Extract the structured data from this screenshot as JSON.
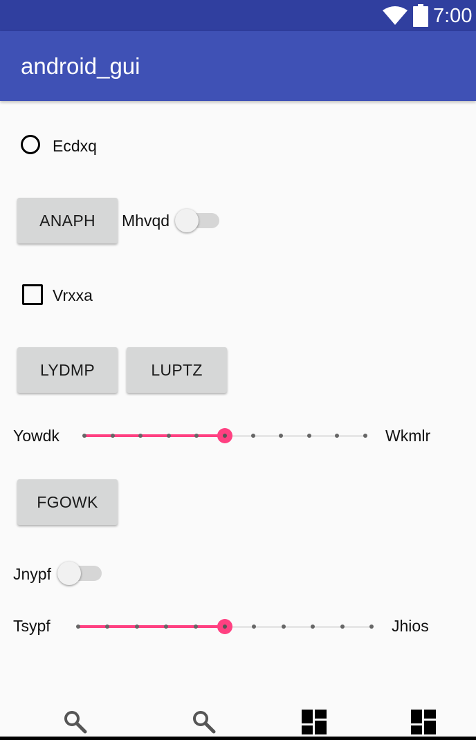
{
  "status_bar": {
    "time": "7:00"
  },
  "app_bar": {
    "title": "android_gui"
  },
  "radio": {
    "label": "Ecdxq",
    "checked": false
  },
  "button_anaph": {
    "label": "ANAPH"
  },
  "switch_mhvqd": {
    "label": "Mhvqd",
    "on": false
  },
  "checkbox": {
    "label": "Vrxxa",
    "checked": false
  },
  "button_lydmp": {
    "label": "LYDMP"
  },
  "button_luptz": {
    "label": "LUPTZ"
  },
  "seekbar_1": {
    "left_label": "Yowdk",
    "right_label": "Wkmlr",
    "value": 5,
    "max": 10
  },
  "button_fgowk": {
    "label": "FGOWK"
  },
  "switch_jnypf": {
    "label": "Jnypf",
    "on": false
  },
  "seekbar_2": {
    "left_label": "Tsypf",
    "right_label": "Jhios",
    "value": 5,
    "max": 10
  },
  "bottom_nav": {
    "items": [
      "search-icon",
      "search-icon",
      "dashboard-icon",
      "dashboard-icon"
    ]
  },
  "colors": {
    "status_bar": "#303f9f",
    "app_bar": "#3f51b5",
    "accent": "#ff4081"
  }
}
